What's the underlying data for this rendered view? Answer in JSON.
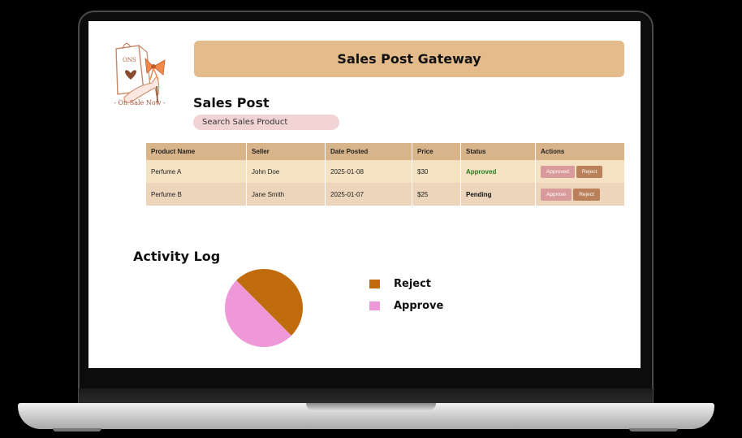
{
  "app": {
    "title": "Sales Post Gateway",
    "logo_text": "- On Sale Now -",
    "logo_mark": "ONS"
  },
  "sales_post": {
    "title": "Sales Post",
    "search_placeholder": "Search Sales Product"
  },
  "table": {
    "columns": [
      "Product Name",
      "Seller",
      "Date Posted",
      "Price",
      "Status",
      "Actions"
    ],
    "rows": [
      {
        "product": "Perfume A",
        "seller": "John Doe",
        "date": "2025-01-08",
        "price": "$30",
        "status": "Approved",
        "actions": [
          "Approved",
          "Reject"
        ]
      },
      {
        "product": "Perfume B",
        "seller": "Jane Smith",
        "date": "2025-01-07",
        "price": "$25",
        "status": "Pending",
        "actions": [
          "Approve",
          "Reject"
        ]
      }
    ]
  },
  "activity_log": {
    "title": "Activity Log"
  },
  "chart_data": {
    "type": "pie",
    "title": "",
    "slices": [
      {
        "name": "Reject",
        "value": 50,
        "color": "#c06c0c"
      },
      {
        "name": "Approve",
        "value": 50,
        "color": "#ee98d8"
      }
    ],
    "legend": "right"
  }
}
